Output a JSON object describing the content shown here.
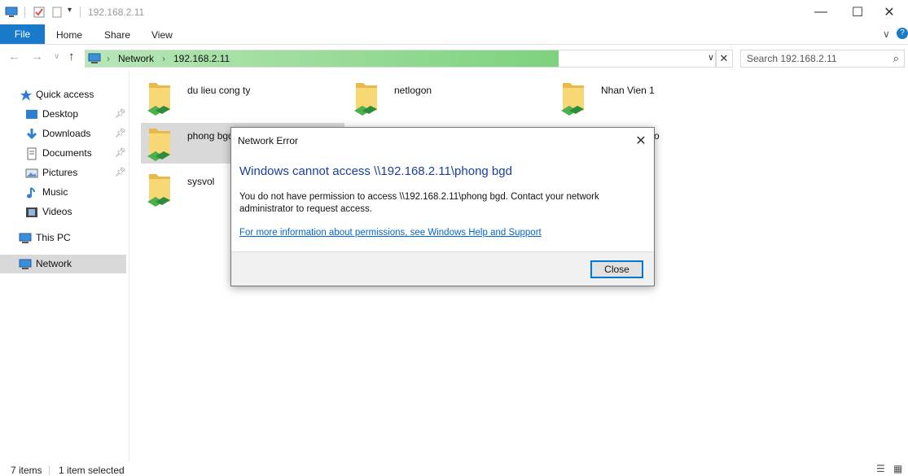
{
  "window": {
    "title": "192.168.2.11"
  },
  "ribbon": {
    "tabs": [
      "File",
      "Home",
      "Share",
      "View"
    ]
  },
  "address": {
    "crumbs": [
      "Network",
      "192.168.2.11"
    ],
    "load_progress": 0.75
  },
  "search": {
    "placeholder": "Search 192.168.2.11"
  },
  "nav": {
    "items": [
      {
        "label": "Quick access",
        "icon": "star-icon"
      },
      {
        "label": "Desktop",
        "icon": "desktop-icon",
        "pinned": true
      },
      {
        "label": "Downloads",
        "icon": "download-icon",
        "pinned": true
      },
      {
        "label": "Documents",
        "icon": "documents-icon",
        "pinned": true
      },
      {
        "label": "Pictures",
        "icon": "pictures-icon",
        "pinned": true
      },
      {
        "label": "Music",
        "icon": "music-icon"
      },
      {
        "label": "Videos",
        "icon": "videos-icon"
      },
      {
        "label": "This PC",
        "icon": "pc-icon"
      },
      {
        "label": "Network",
        "icon": "network-icon",
        "selected": true
      }
    ]
  },
  "folders": [
    {
      "name": "du lieu cong ty"
    },
    {
      "name": "netlogon"
    },
    {
      "name": "Nhan Vien 1"
    },
    {
      "name": "phong bgd",
      "selected": true
    },
    {
      "name": "sysvol"
    }
  ],
  "dialog": {
    "title": "Network Error",
    "heading": "Windows cannot access \\\\192.168.2.11\\phong bgd",
    "message": "You do not have permission to access \\\\192.168.2.11\\phong bgd. Contact your network administrator to request access.",
    "link": "For more information about permissions, see Windows Help and Support",
    "button": "Close"
  },
  "status": {
    "items_count": "7 items",
    "selected": "1 item selected"
  },
  "colors": {
    "accent": "#1979ca",
    "progress": "#7dd27d",
    "heading": "#1a3f9c",
    "link": "#0066cc"
  }
}
